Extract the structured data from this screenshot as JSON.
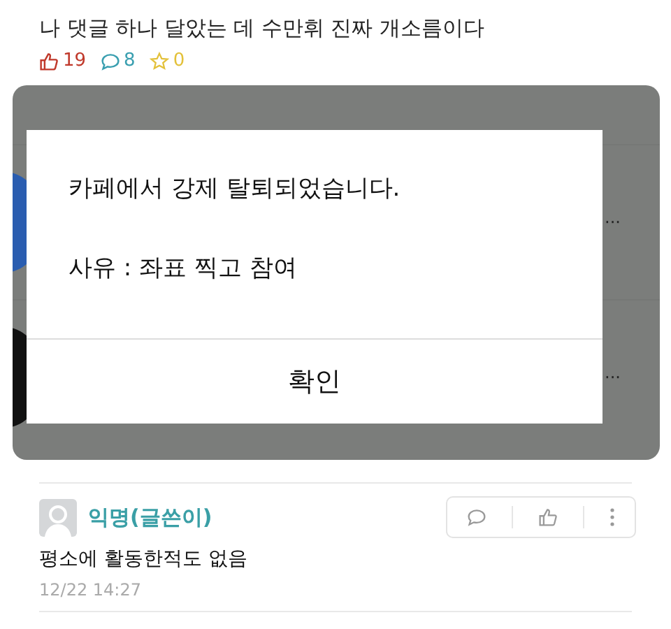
{
  "post": {
    "title": "나 댓글 하나 달았는 데 수만휘 진짜 개소름이다",
    "stats": [
      {
        "kind": "like",
        "count": "19",
        "color": "#c0392b"
      },
      {
        "kind": "comment",
        "count": "8",
        "color": "#3a9fb0"
      },
      {
        "kind": "star",
        "count": "0",
        "color": "#e3c13a"
      }
    ]
  },
  "screenshot": {
    "rows": [
      {
        "more": "···",
        "color": "#2a5db0"
      },
      {
        "more": "···",
        "color": "#111111"
      }
    ],
    "dialog": {
      "message": "카페에서 강제 탈퇴되었습니다.",
      "reason": "사유 : 좌표 찍고 참여",
      "confirm": "확인"
    }
  },
  "comment": {
    "author": "익명(글쓴이)",
    "text": "평소에 활동한적도 없음",
    "time": "12/22 14:27"
  }
}
